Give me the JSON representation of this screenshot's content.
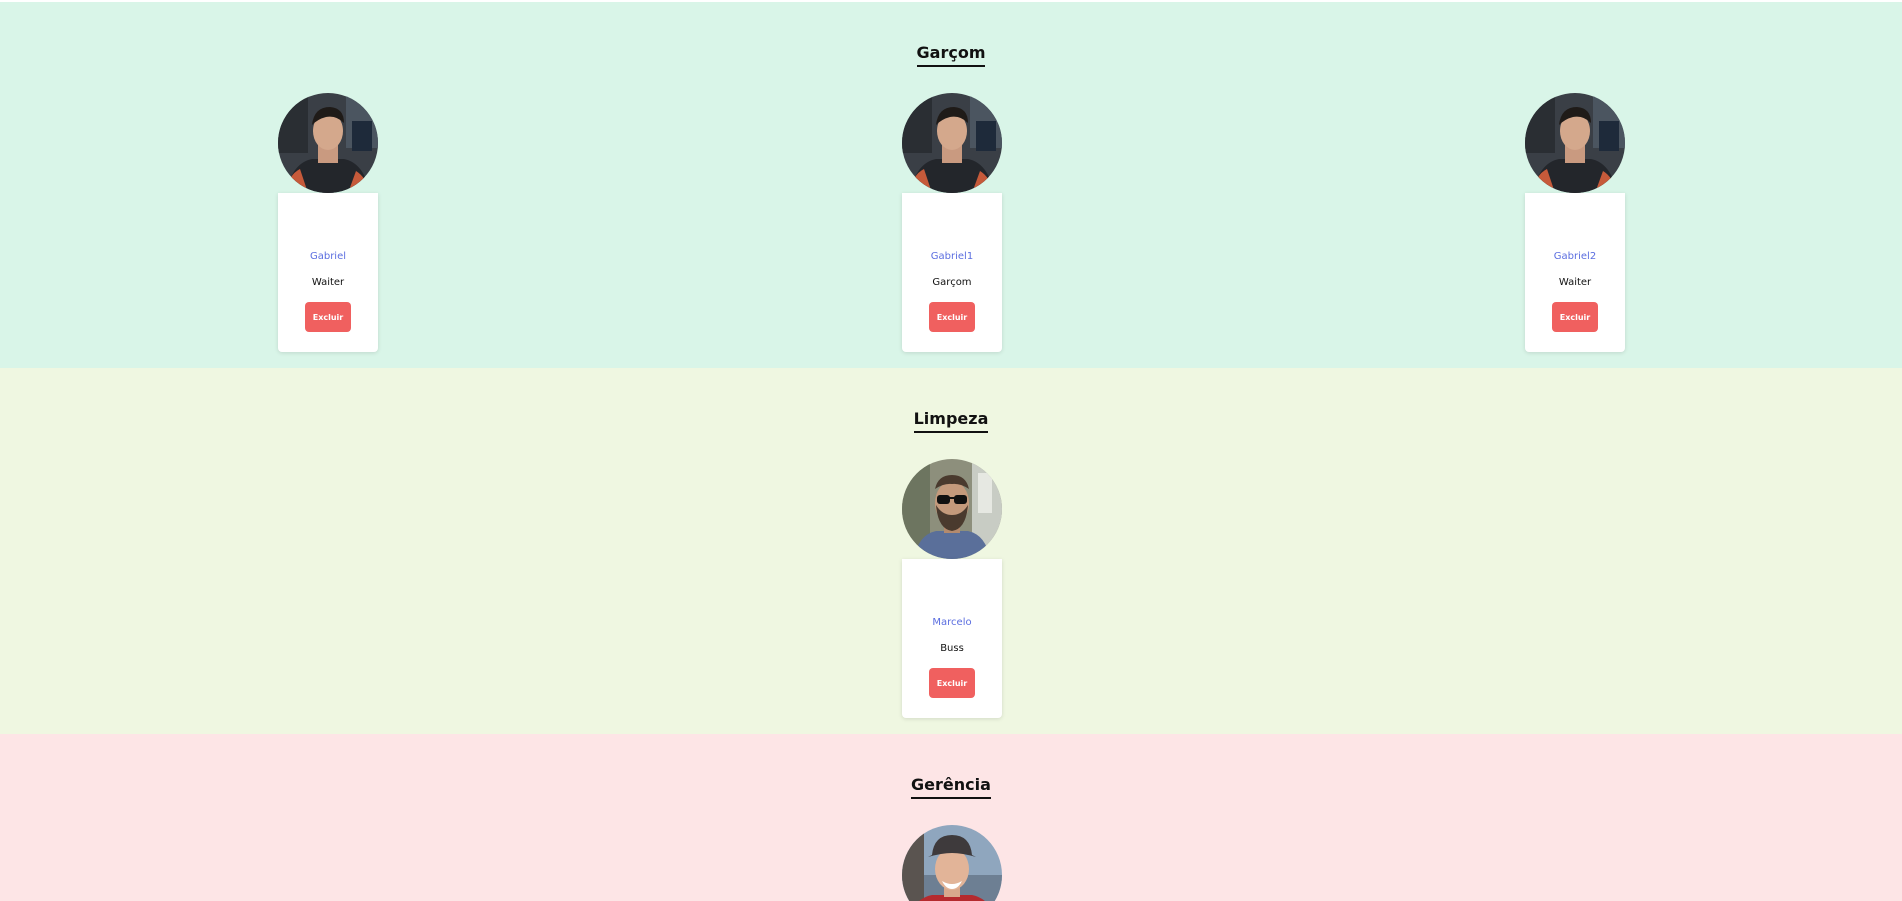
{
  "sections": {
    "garcom": {
      "title": "Garçom",
      "background": "#d9f5e8",
      "employees": [
        {
          "name": "Gabriel",
          "role": "Waiter",
          "delete_label": "Excluir"
        },
        {
          "name": "Gabriel1",
          "role": "Garçom",
          "delete_label": "Excluir"
        },
        {
          "name": "Gabriel2",
          "role": "Waiter",
          "delete_label": "Excluir"
        }
      ]
    },
    "limpeza": {
      "title": "Limpeza",
      "background": "#eff7e1",
      "employees": [
        {
          "name": "Marcelo",
          "role": "Buss",
          "delete_label": "Excluir"
        }
      ]
    },
    "gerencia": {
      "title": "Gerência",
      "background": "#fde5e6",
      "employees": []
    }
  },
  "colors": {
    "name_link": "#5b6ee0",
    "delete_button": "#f0605f"
  },
  "icons": {
    "avatar": "user-photo"
  }
}
